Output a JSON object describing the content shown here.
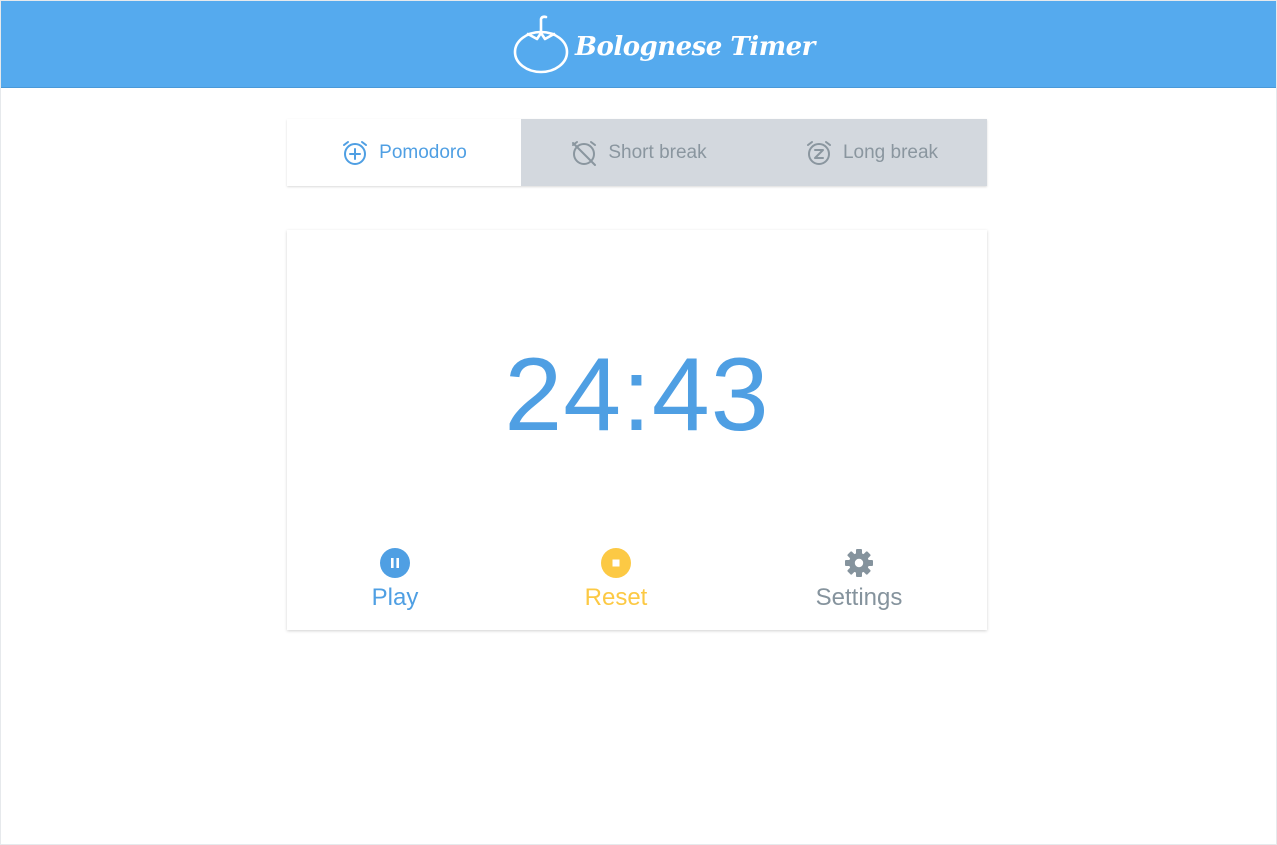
{
  "header": {
    "title": "Bolognese Timer",
    "logo_icon": "tomato-icon",
    "color": "#55aaee"
  },
  "tabs": [
    {
      "label": "Pomodoro",
      "icon": "alarm-plus-icon",
      "active": true
    },
    {
      "label": "Short break",
      "icon": "alarm-off-icon",
      "active": false
    },
    {
      "label": "Long break",
      "icon": "alarm-snooze-icon",
      "active": false
    }
  ],
  "timer": {
    "time": "24:43"
  },
  "controls": {
    "play": {
      "label": "Play",
      "icon": "pause-icon",
      "color": "#4f9fe3"
    },
    "reset": {
      "label": "Reset",
      "icon": "stop-icon",
      "color": "#fcc944"
    },
    "settings": {
      "label": "Settings",
      "icon": "gear-icon",
      "color": "#85939d"
    }
  }
}
